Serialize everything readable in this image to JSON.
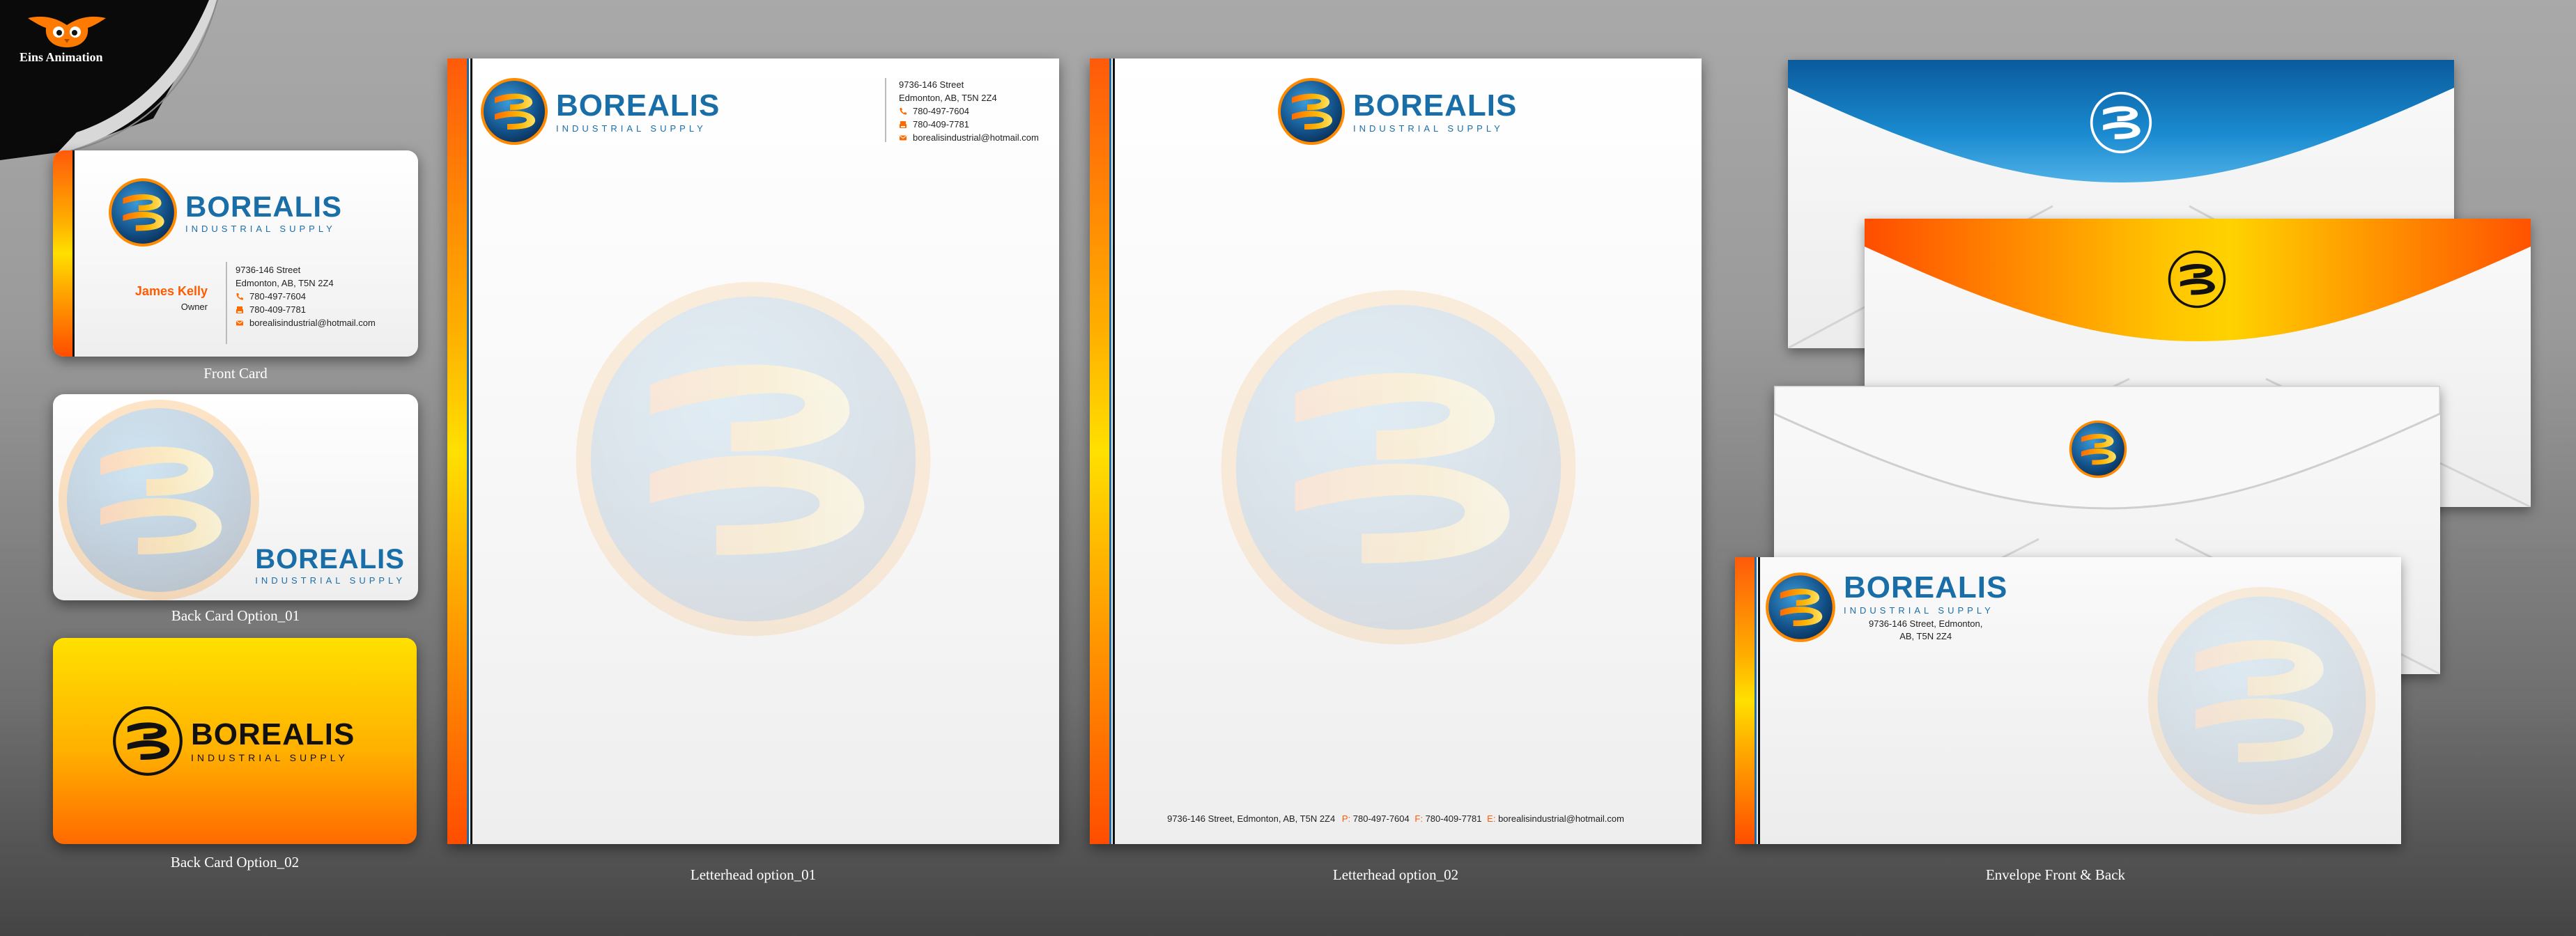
{
  "brand": {
    "name": "BOREALIS",
    "subtitle": "INDUSTRIAL SUPPLY",
    "colors": {
      "blue": "#1a6ea8",
      "orange": "#ff5a0a",
      "yellow": "#ffd400",
      "dark": "#111111"
    }
  },
  "corner_badge": {
    "label": "Eins Animation",
    "icon": "owl-mascot-icon"
  },
  "contact": {
    "street": "9736-146 Street",
    "city": "Edmonton, AB, T5N 2Z4",
    "phone": "780-497-7604",
    "fax": "780-409-7781",
    "email": "borealisindustrial@hotmail.com"
  },
  "front_card": {
    "person_name": "James Kelly",
    "person_title": "Owner",
    "caption": "Front Card"
  },
  "back_card_1": {
    "caption": "Back Card Option_01"
  },
  "back_card_2": {
    "caption": "Back Card Option_02"
  },
  "letterhead_1": {
    "caption": "Letterhead option_01"
  },
  "letterhead_2": {
    "caption": "Letterhead option_02",
    "footer": {
      "address": "9736-146 Street, Edmonton, AB, T5N 2Z4",
      "p_label": "P:",
      "f_label": "F:",
      "e_label": "E:"
    }
  },
  "envelope": {
    "caption": "Envelope Front & Back",
    "address_line1": "9736-146 Street, Edmonton,",
    "address_line2": "AB, T5N 2Z4"
  }
}
